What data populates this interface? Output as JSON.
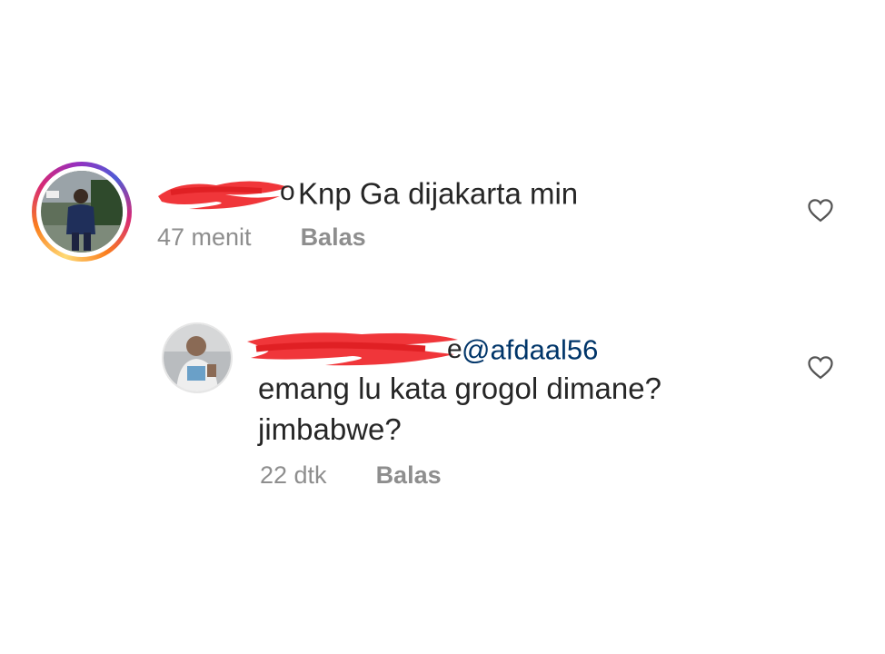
{
  "comments": [
    {
      "text": "Knp Ga dijakarta min",
      "time": "47 menit",
      "reply_label": "Balas",
      "icons": {
        "avatar_ring": "story-ring-gradient",
        "like": "heart-outline-icon"
      }
    },
    {
      "username_end": "e",
      "mention": "@afdaal56",
      "text_line1": "emang lu kata grogol dimane?",
      "text_line2": "jimbabwe?",
      "time": "22 dtk",
      "reply_label": "Balas",
      "icons": {
        "like": "heart-outline-icon"
      }
    }
  ],
  "colors": {
    "text": "#262626",
    "meta": "#8e8e8e",
    "mention": "#003569",
    "redaction": "#f0363a"
  }
}
